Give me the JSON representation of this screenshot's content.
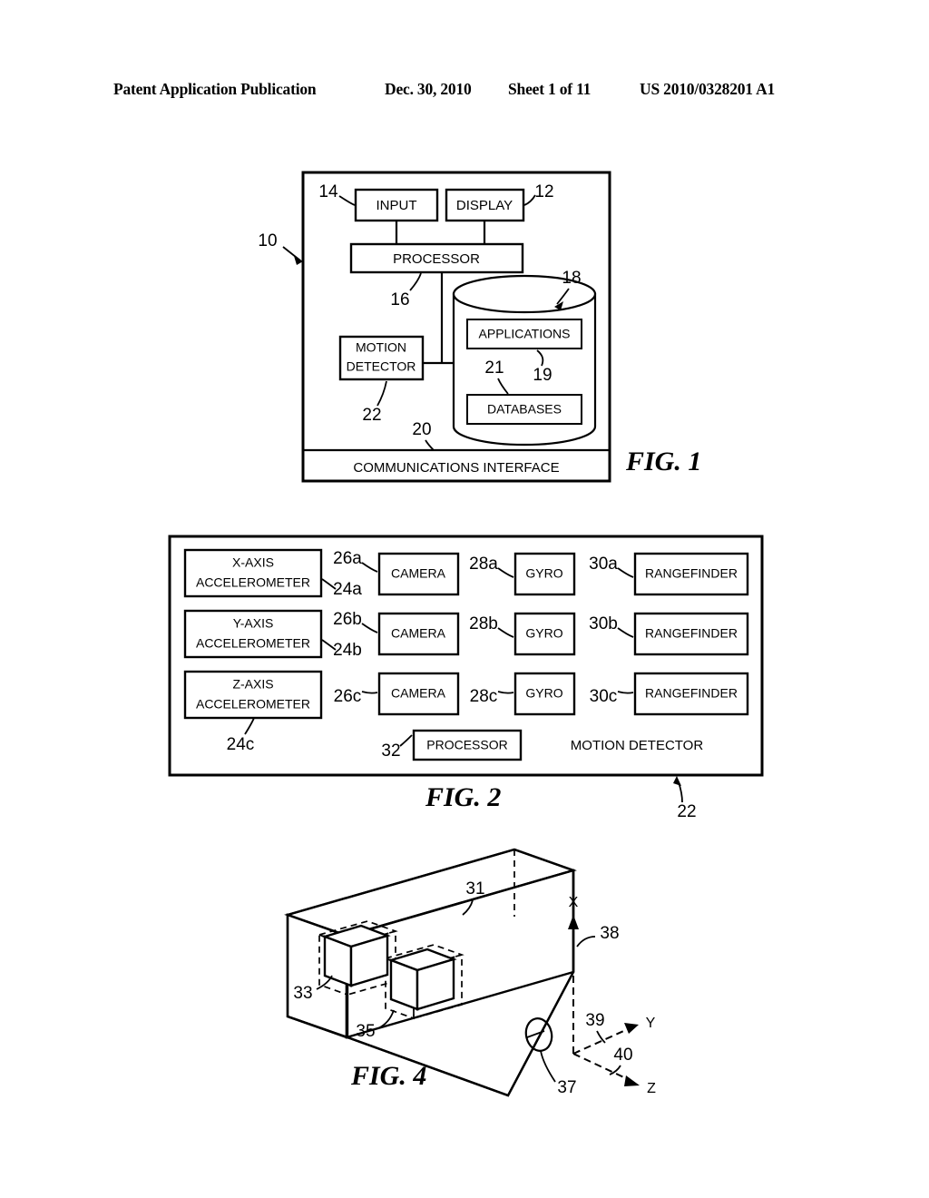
{
  "header": {
    "title": "Patent Application Publication",
    "date": "Dec. 30, 2010",
    "sheet": "Sheet 1 of 11",
    "pub_number": "US 2010/0328201 A1"
  },
  "fig1": {
    "label": "FIG. 1",
    "device_ref": "10",
    "boxes": {
      "input": "INPUT",
      "input_ref": "14",
      "display": "DISPLAY",
      "display_ref": "12",
      "processor": "PROCESSOR",
      "processor_ref": "16",
      "motion_detector_line1": "MOTION",
      "motion_detector_line2": "DETECTOR",
      "motion_detector_ref": "22",
      "memory_ref": "18",
      "applications": "APPLICATIONS",
      "applications_ref": "19",
      "databases": "DATABASES",
      "databases_ref": "21",
      "comms": "COMMUNICATIONS INTERFACE",
      "comms_ref": "20"
    }
  },
  "fig2": {
    "label": "FIG. 2",
    "block_ref": "22",
    "block_title": "MOTION DETECTOR",
    "processor": "PROCESSOR",
    "processor_ref": "32",
    "rows": [
      {
        "accel_line1": "X-AXIS",
        "accel_line2": "ACCELEROMETER",
        "accel_ref": "24a",
        "camera": "CAMERA",
        "camera_ref": "26a",
        "gyro": "GYRO",
        "gyro_ref": "28a",
        "rangefinder": "RANGEFINDER",
        "rangefinder_ref": "30a"
      },
      {
        "accel_line1": "Y-AXIS",
        "accel_line2": "ACCELEROMETER",
        "accel_ref": "24b",
        "camera": "CAMERA",
        "camera_ref": "26b",
        "gyro": "GYRO",
        "gyro_ref": "28b",
        "rangefinder": "RANGEFINDER",
        "rangefinder_ref": "30b"
      },
      {
        "accel_line1": "Z-AXIS",
        "accel_line2": "ACCELEROMETER",
        "accel_ref": "24c",
        "camera": "CAMERA",
        "camera_ref": "26c",
        "gyro": "GYRO",
        "gyro_ref": "28c",
        "rangefinder": "RANGEFINDER",
        "rangefinder_ref": "30c"
      }
    ]
  },
  "fig4": {
    "label": "FIG. 4",
    "body_ref": "31",
    "cube1_ref": "33",
    "cube2_ref": "35",
    "aperture_ref": "37",
    "x_axis_label": "X",
    "y_axis_label": "Y",
    "z_axis_label": "Z",
    "x_axis_ref": "38",
    "y_axis_ref": "39",
    "z_axis_ref": "40"
  }
}
